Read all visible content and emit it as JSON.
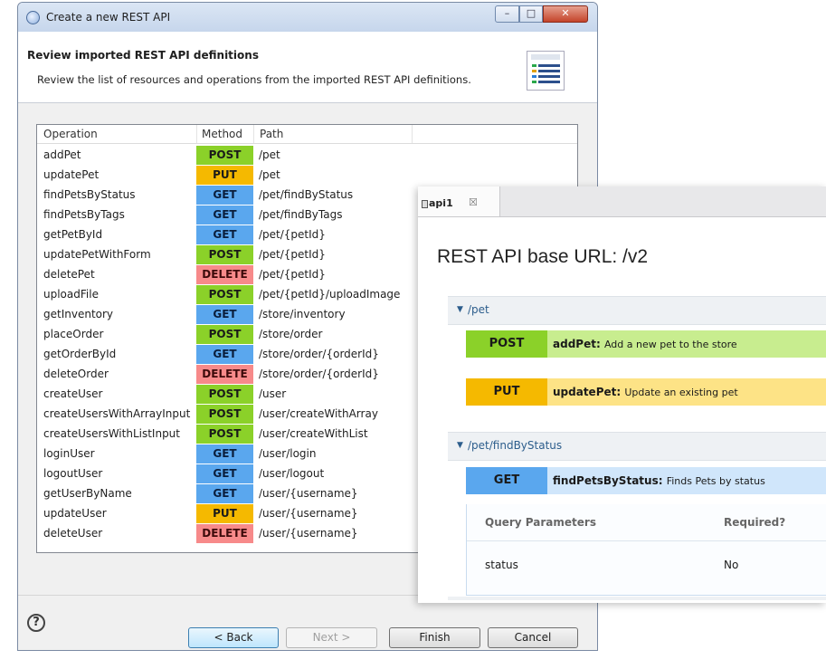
{
  "window": {
    "title": "Create a new REST API"
  },
  "header": {
    "title": "Review imported REST API definitions",
    "subtitle": "Review the list of resources and operations from the imported REST API definitions."
  },
  "table": {
    "columns": [
      "Operation",
      "Method",
      "Path"
    ],
    "rows": [
      {
        "operation": "addPet",
        "method": "POST",
        "path": "/pet"
      },
      {
        "operation": "updatePet",
        "method": "PUT",
        "path": "/pet"
      },
      {
        "operation": "findPetsByStatus",
        "method": "GET",
        "path": "/pet/findByStatus"
      },
      {
        "operation": "findPetsByTags",
        "method": "GET",
        "path": "/pet/findByTags"
      },
      {
        "operation": "getPetById",
        "method": "GET",
        "path": "/pet/{petId}"
      },
      {
        "operation": "updatePetWithForm",
        "method": "POST",
        "path": "/pet/{petId}"
      },
      {
        "operation": "deletePet",
        "method": "DELETE",
        "path": "/pet/{petId}"
      },
      {
        "operation": "uploadFile",
        "method": "POST",
        "path": "/pet/{petId}/uploadImage"
      },
      {
        "operation": "getInventory",
        "method": "GET",
        "path": "/store/inventory"
      },
      {
        "operation": "placeOrder",
        "method": "POST",
        "path": "/store/order"
      },
      {
        "operation": "getOrderById",
        "method": "GET",
        "path": "/store/order/{orderId}"
      },
      {
        "operation": "deleteOrder",
        "method": "DELETE",
        "path": "/store/order/{orderId}"
      },
      {
        "operation": "createUser",
        "method": "POST",
        "path": "/user"
      },
      {
        "operation": "createUsersWithArrayInput",
        "method": "POST",
        "path": "/user/createWithArray"
      },
      {
        "operation": "createUsersWithListInput",
        "method": "POST",
        "path": "/user/createWithList"
      },
      {
        "operation": "loginUser",
        "method": "GET",
        "path": "/user/login"
      },
      {
        "operation": "logoutUser",
        "method": "GET",
        "path": "/user/logout"
      },
      {
        "operation": "getUserByName",
        "method": "GET",
        "path": "/user/{username}"
      },
      {
        "operation": "updateUser",
        "method": "PUT",
        "path": "/user/{username}"
      },
      {
        "operation": "deleteUser",
        "method": "DELETE",
        "path": "/user/{username}"
      }
    ]
  },
  "buttons": {
    "help": "?",
    "back": "< Back",
    "next": "Next >",
    "finish": "Finish",
    "cancel": "Cancel"
  },
  "editor": {
    "tab_label": "api1",
    "tab_close": "☒",
    "base_url_title": "REST API base URL:   /v2",
    "sections": [
      {
        "path": "/pet"
      },
      {
        "path": "/pet/findByStatus"
      }
    ],
    "operations": [
      {
        "method": "POST",
        "name": "addPet:",
        "description": "Add a new pet to the store"
      },
      {
        "method": "PUT",
        "name": "updatePet:",
        "description": "Update an existing pet"
      },
      {
        "method": "GET",
        "name": "findPetsByStatus:",
        "description": "Finds Pets by status"
      }
    ],
    "params": {
      "header_name": "Query Parameters",
      "header_required": "Required?",
      "rows": [
        {
          "name": "status",
          "required": "No"
        }
      ]
    }
  },
  "colors": {
    "post": "#8bd129",
    "put": "#f5b900",
    "get": "#5aa7ee",
    "delete": "#f78a8a"
  }
}
